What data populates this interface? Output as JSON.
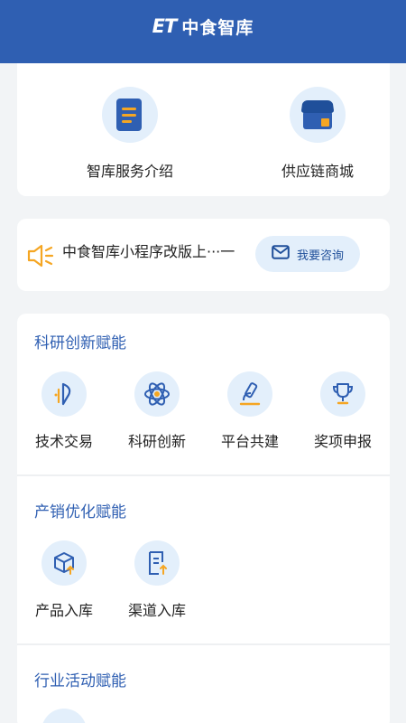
{
  "header": {
    "logo": "ET",
    "title": "中食智库"
  },
  "quick": [
    {
      "label": "智库服务介绍",
      "icon": "document-icon"
    },
    {
      "label": "供应链商城",
      "icon": "store-icon"
    }
  ],
  "notice": {
    "text": "中食智库小程序改版上···一",
    "button": "我要咨询",
    "icon": "megaphone-icon",
    "button_icon": "mail-icon"
  },
  "sections": [
    {
      "title": "科研创新赋能",
      "items": [
        {
          "label": "技术交易",
          "icon": "pen-icon"
        },
        {
          "label": "科研创新",
          "icon": "atom-icon"
        },
        {
          "label": "平台共建",
          "icon": "microscope-icon"
        },
        {
          "label": "奖项申报",
          "icon": "trophy-icon"
        }
      ]
    },
    {
      "title": "产销优化赋能",
      "items": [
        {
          "label": "产品入库",
          "icon": "box-upload-icon"
        },
        {
          "label": "渠道入库",
          "icon": "document-upload-icon"
        }
      ]
    },
    {
      "title": "行业活动赋能",
      "items": []
    }
  ],
  "colors": {
    "primary": "#2f5fb2",
    "accent": "#f5a623",
    "icon_bg": "#e3effb"
  }
}
